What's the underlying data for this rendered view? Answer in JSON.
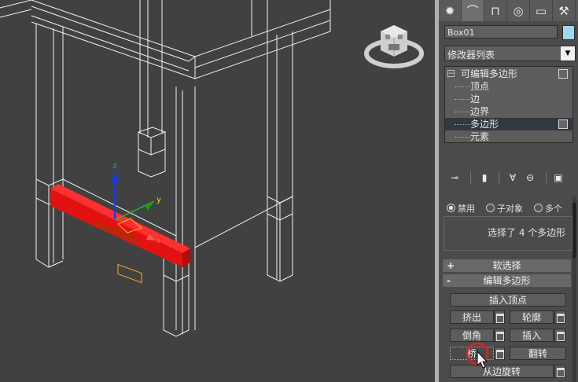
{
  "viewport": {
    "axis_labels": {
      "x": "x",
      "y": "y",
      "z": "z"
    },
    "colors": {
      "wire": "#f2f2f2",
      "selection": "#ff1a1a",
      "background": "#414141"
    }
  },
  "panel": {
    "tabs": [
      {
        "icon": "create-icon",
        "glyph": "✹"
      },
      {
        "icon": "modify-icon",
        "glyph": "⌒"
      },
      {
        "icon": "hierarchy-icon",
        "glyph": "⊓"
      },
      {
        "icon": "motion-icon",
        "glyph": "◎"
      },
      {
        "icon": "display-icon",
        "glyph": "▭"
      },
      {
        "icon": "utilities-icon",
        "glyph": "⚒"
      }
    ],
    "object_name": "Box01",
    "object_color": "#9fd7ec",
    "modifier_list": "修改器列表",
    "stack": {
      "root": "可编辑多边形",
      "items": [
        "顶点",
        "边",
        "边界",
        "多边形",
        "元素"
      ],
      "selected": "多边形"
    },
    "selection": {
      "options": [
        "禁用",
        "子对象",
        "多个"
      ],
      "info": "选择了 4 个多边形"
    },
    "soft_selection": {
      "sign": "+",
      "label": "软选择"
    },
    "edit_polygons": {
      "sign": "-",
      "label": "编辑多边形",
      "insert_vertex": "插入顶点",
      "extrude": "挤出",
      "outline": "轮廓",
      "bevel": "倒角",
      "inset": "插入",
      "bridge": "桥",
      "flip": "翻转",
      "hinge_from_edge": "从边旋转"
    }
  }
}
